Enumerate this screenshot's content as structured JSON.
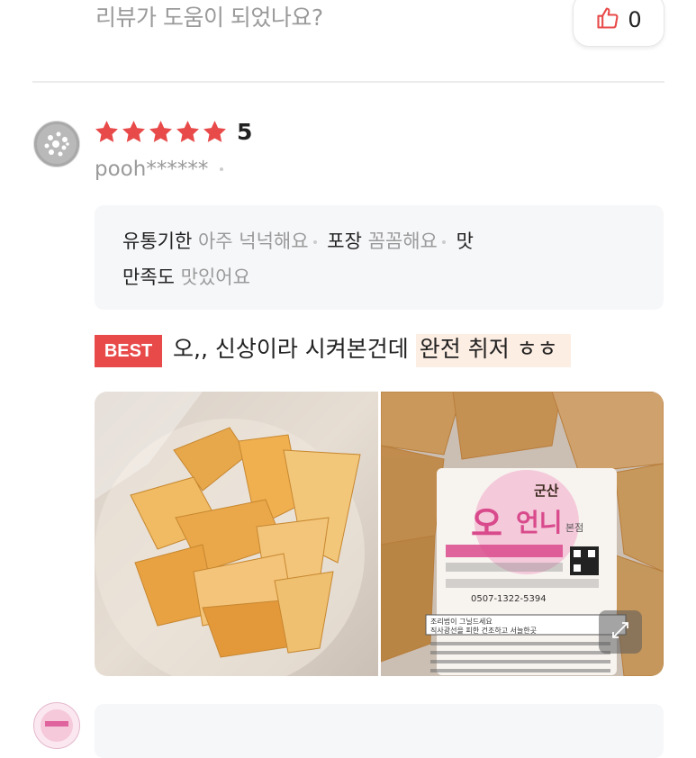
{
  "previous_review": {
    "helpful_question": "리뷰가 도움이 되었나요?",
    "helpful_count": "0"
  },
  "review": {
    "rating": "5",
    "star_count": 5,
    "username": "pooh******",
    "attributes_line1": [
      {
        "key": "유통기한",
        "value": "아주 넉넉해요"
      },
      {
        "key": "포장",
        "value": "꼼꼼해요"
      },
      {
        "key": "맛",
        "value": ""
      }
    ],
    "attributes_line2": [
      {
        "key": "만족도",
        "value": "맛있어요"
      }
    ],
    "best_badge": "BEST",
    "text_plain": "오,, 신상이라 시켜본건데 ",
    "text_highlight": "완전 취저 ㅎㅎ",
    "photo_label": {
      "brand_top": "군산",
      "brand_main": "오",
      "brand_sub": "언니",
      "brand_suffix": "본점",
      "phone": "0507-1322-5394",
      "note_line1": "조리법이 그닐드세요",
      "note_line2": "직사광선을 피한 건조하고 서늘한곳"
    }
  },
  "colors": {
    "star": "#e84a4a",
    "best_badge": "#e84a4a",
    "highlight_bg": "#fdeee3",
    "muted_text": "#9a9a9a",
    "attr_box_bg": "#f6f7f9",
    "thumb_icon": "#e84a4a"
  },
  "icons": {
    "helpful": "thumbs-up-icon",
    "expand": "expand-icon",
    "star": "star-icon"
  }
}
